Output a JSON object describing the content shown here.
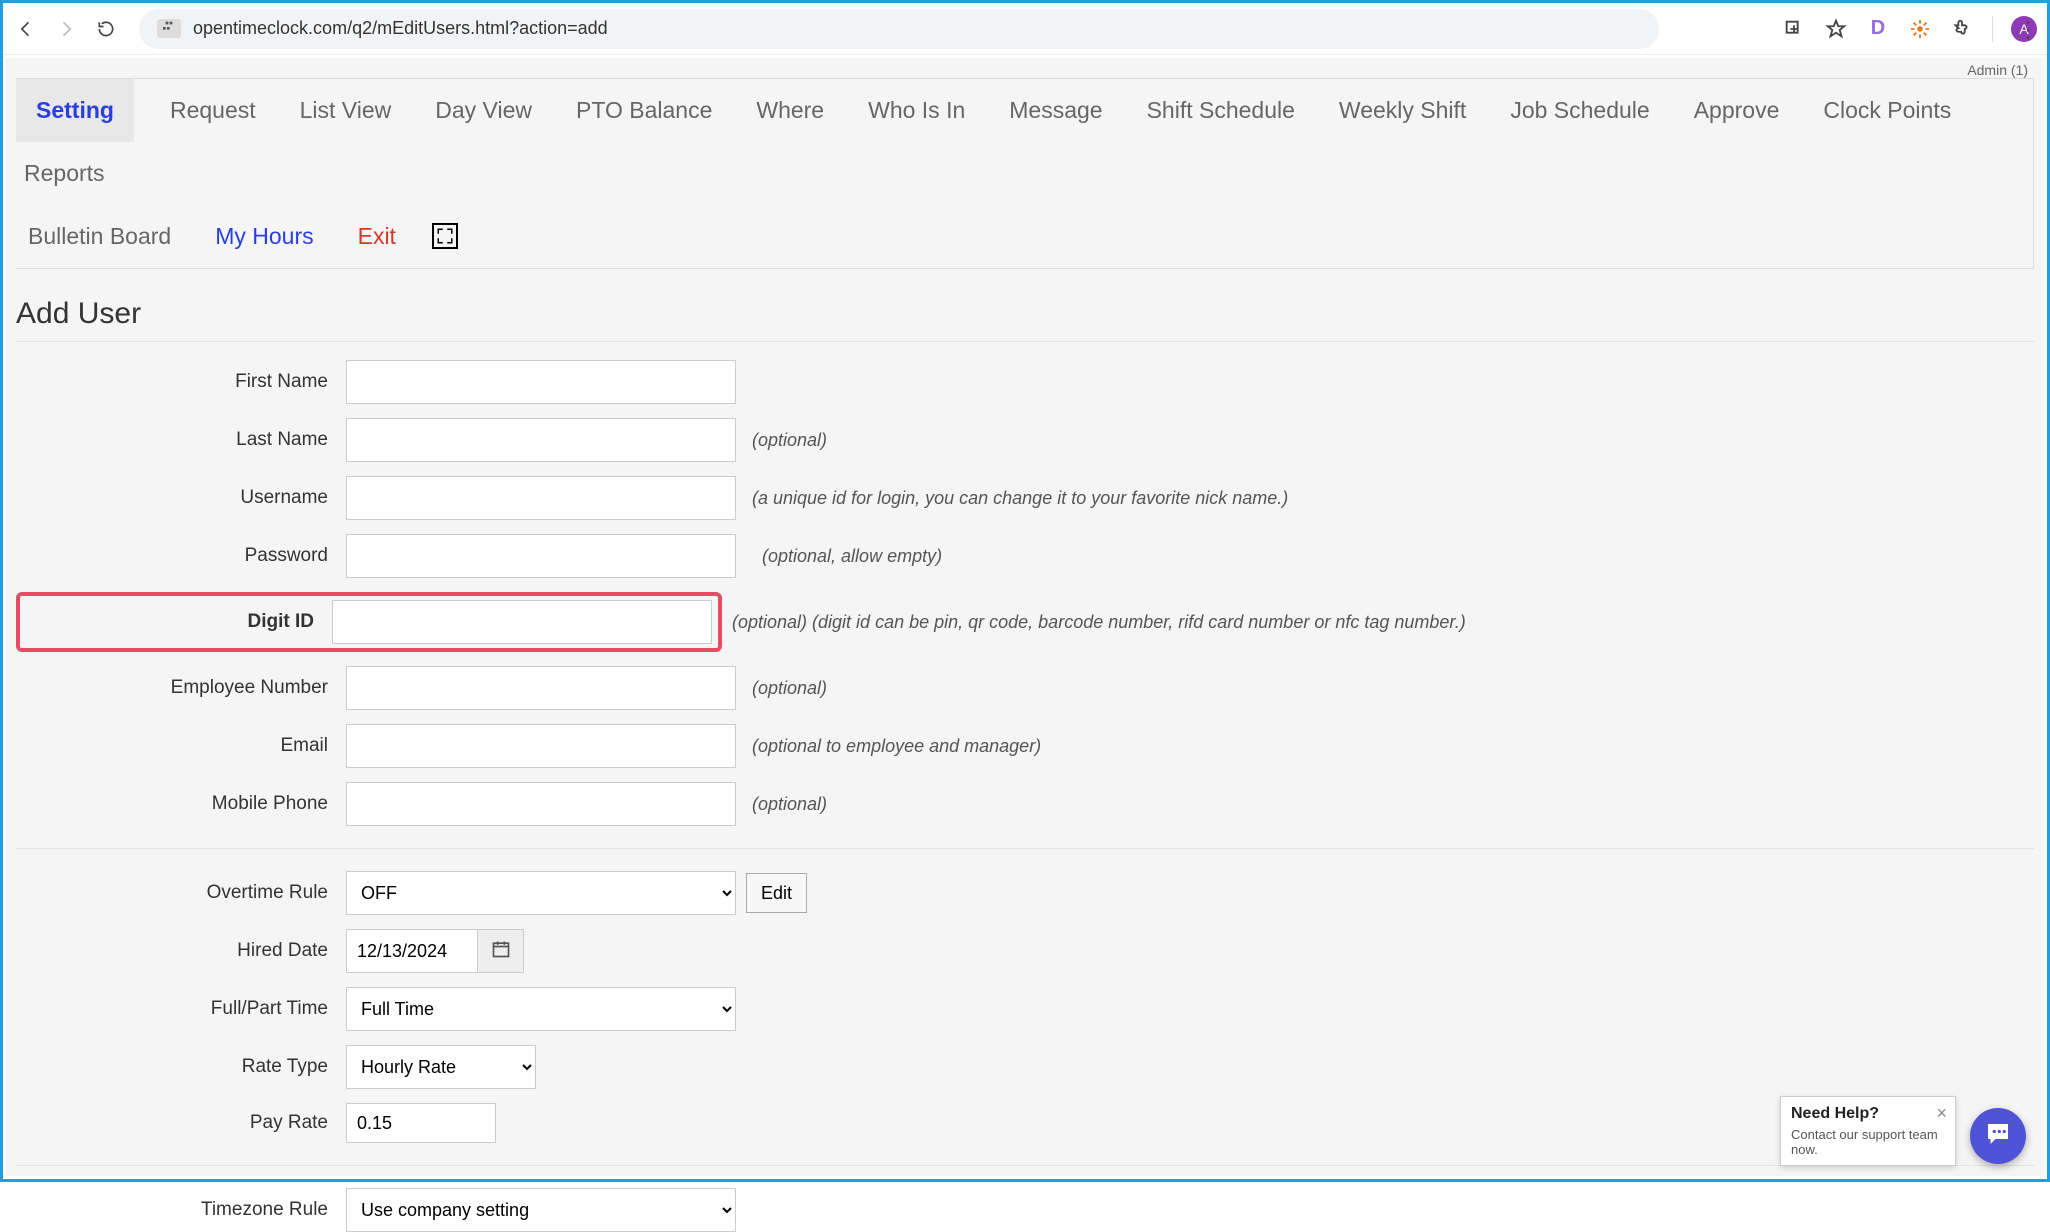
{
  "browser": {
    "url": "opentimeclock.com/q2/mEditUsers.html?action=add",
    "avatar_letter": "A",
    "ext_d_letter": "D"
  },
  "admin_line": "Admin (1)",
  "tabs_row1": [
    "Setting",
    "Request",
    "List View",
    "Day View",
    "PTO Balance",
    "Where",
    "Who Is In",
    "Message",
    "Shift Schedule",
    "Weekly Shift",
    "Job Schedule",
    "Approve",
    "Clock Points",
    "Reports"
  ],
  "tabs_row2": {
    "bulletin": "Bulletin Board",
    "myhours": "My Hours",
    "exit": "Exit"
  },
  "page_title": "Add User",
  "fields": {
    "first_name": {
      "label": "First Name",
      "value": ""
    },
    "last_name": {
      "label": "Last Name",
      "value": "",
      "hint": "(optional)"
    },
    "username": {
      "label": "Username",
      "value": "",
      "hint": "(a unique id for login, you can change it to your favorite nick name.)"
    },
    "password": {
      "label": "Password",
      "value": "",
      "hint": "(optional, allow empty)"
    },
    "digit_id": {
      "label": "Digit ID",
      "value": "",
      "hint": "(optional) (digit id can be pin, qr code, barcode number, rifd card number or nfc tag number.)"
    },
    "emp_number": {
      "label": "Employee Number",
      "value": "",
      "hint": "(optional)"
    },
    "email": {
      "label": "Email",
      "value": "",
      "hint": "(optional to employee and manager)"
    },
    "mobile": {
      "label": "Mobile Phone",
      "value": "",
      "hint": "(optional)"
    }
  },
  "overtime": {
    "label": "Overtime Rule",
    "value": "OFF",
    "edit": "Edit"
  },
  "hired": {
    "label": "Hired Date",
    "value": "12/13/2024"
  },
  "fullpart": {
    "label": "Full/Part Time",
    "value": "Full Time"
  },
  "ratetype": {
    "label": "Rate Type",
    "value": "Hourly Rate"
  },
  "payrate": {
    "label": "Pay Rate",
    "value": "0.15"
  },
  "timezone": {
    "label": "Timezone Rule",
    "value": "Use company setting"
  },
  "help": {
    "title": "Need Help?",
    "sub": "Contact our support team now."
  }
}
